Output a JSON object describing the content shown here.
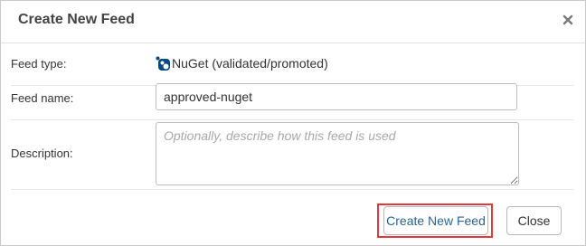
{
  "dialog": {
    "title": "Create New Feed",
    "close_icon": "close-icon"
  },
  "form": {
    "feed_type": {
      "label": "Feed type:",
      "icon": "nuget-icon",
      "value": "NuGet (validated/promoted)"
    },
    "feed_name": {
      "label": "Feed name:",
      "value": "approved-nuget"
    },
    "description": {
      "label": "Description:",
      "placeholder": "Optionally, describe how this feed is used",
      "value": ""
    }
  },
  "buttons": {
    "create_label": "Create New Feed",
    "close_label": "Close"
  },
  "colors": {
    "highlight": "#e03a3a",
    "create_text": "#2a6496",
    "nuget_blue": "#004880"
  }
}
